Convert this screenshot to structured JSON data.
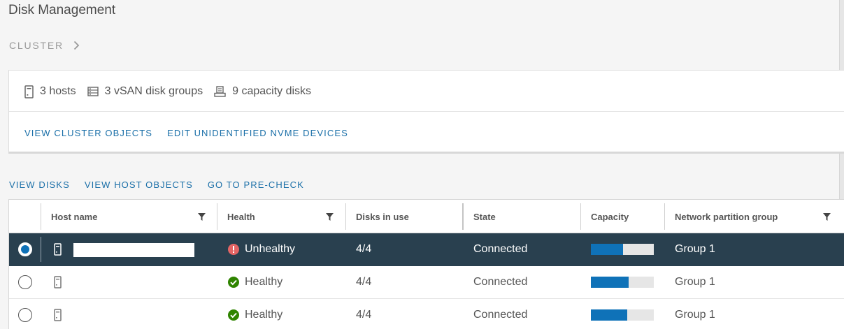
{
  "page": {
    "title": "Disk Management"
  },
  "breadcrumb": {
    "label": "CLUSTER"
  },
  "summary": {
    "hosts": "3 hosts",
    "disk_groups": "3 vSAN disk groups",
    "capacity_disks": "9 capacity disks",
    "links": [
      "VIEW CLUSTER OBJECTS",
      "EDIT UNIDENTIFIED NVME DEVICES"
    ]
  },
  "actions": [
    "VIEW DISKS",
    "VIEW HOST OBJECTS",
    "GO TO PRE-CHECK"
  ],
  "table": {
    "columns": [
      "Host name",
      "Health",
      "Disks in use",
      "State",
      "Capacity",
      "Network partition group"
    ],
    "rows": [
      {
        "selected": true,
        "host": "",
        "health": "Unhealthy",
        "health_icon": "error-icon",
        "disks": "4/4",
        "state": "Connected",
        "capacity_fraction": 0.51,
        "group": "Group 1"
      },
      {
        "selected": false,
        "host": "",
        "health": "Healthy",
        "health_icon": "check-circle-icon",
        "disks": "4/4",
        "state": "Connected",
        "capacity_fraction": 0.6,
        "group": "Group 1"
      },
      {
        "selected": false,
        "host": "",
        "health": "Healthy",
        "health_icon": "check-circle-icon",
        "disks": "4/4",
        "state": "Connected",
        "capacity_fraction": 0.58,
        "group": "Group 1"
      }
    ]
  },
  "colors": {
    "accent": "#0f72b8",
    "link": "#1a6fa8",
    "selected_row": "#29404f",
    "healthy": "#2f8400",
    "unhealthy": "#e46565"
  }
}
